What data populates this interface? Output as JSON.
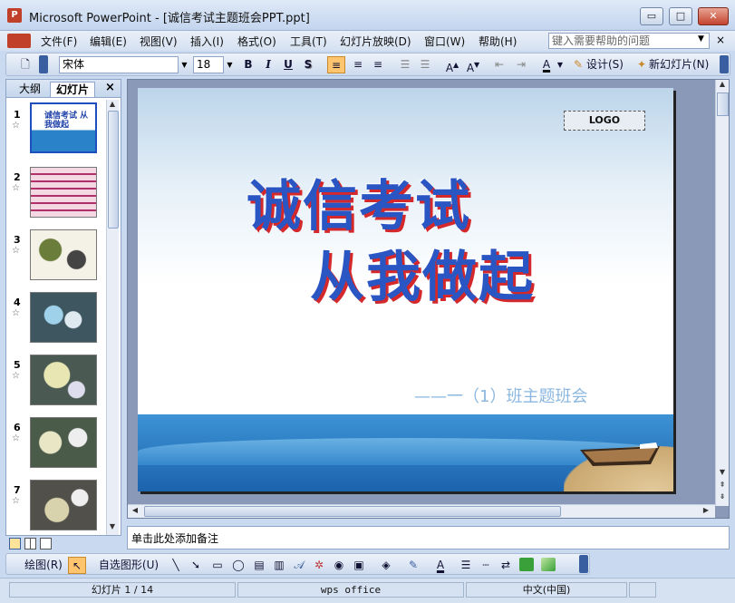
{
  "window": {
    "title": "Microsoft PowerPoint - [诚信考试主题班会PPT.ppt]",
    "app_icon_label": "P",
    "minimize": "▭",
    "maximize": "□",
    "close": "✕"
  },
  "menu": {
    "items": [
      "文件(F)",
      "编辑(E)",
      "视图(V)",
      "插入(I)",
      "格式(O)",
      "工具(T)",
      "幻灯片放映(D)",
      "窗口(W)",
      "帮助(H)"
    ],
    "help_placeholder": "键入需要帮助的问题"
  },
  "toolbar": {
    "font": "宋体",
    "size": "18",
    "bold": "B",
    "italic": "I",
    "underline": "U",
    "shadow": "S",
    "design_label": "设计(S)",
    "new_slide_label": "新幻灯片(N)"
  },
  "left_panel": {
    "tab_outline": "大纲",
    "tab_slides": "幻灯片",
    "close": "×",
    "thumbnails": [
      {
        "num": "1",
        "title": "诚信考试 从我做起"
      },
      {
        "num": "2"
      },
      {
        "num": "3"
      },
      {
        "num": "4"
      },
      {
        "num": "5"
      },
      {
        "num": "6"
      },
      {
        "num": "7"
      }
    ],
    "star": "☆"
  },
  "slide": {
    "logo": "LOGO",
    "title_line1": "诚信考试",
    "title_line2": "从我做起",
    "subtitle": "——一（1）班主题班会"
  },
  "notes": {
    "placeholder": "单击此处添加备注"
  },
  "drawbar": {
    "draw_label": "绘图(R)",
    "autoshape_label": "自选图形(U)"
  },
  "status": {
    "slide_info": "幻灯片 1 / 14",
    "theme": "wps office",
    "language": "中文(中国)"
  },
  "colors": {
    "title_blue": "#2a56c4",
    "title_shadow_red": "#d4282b",
    "subtitle": "#8ab7e0",
    "sea": "#1c63ad"
  }
}
